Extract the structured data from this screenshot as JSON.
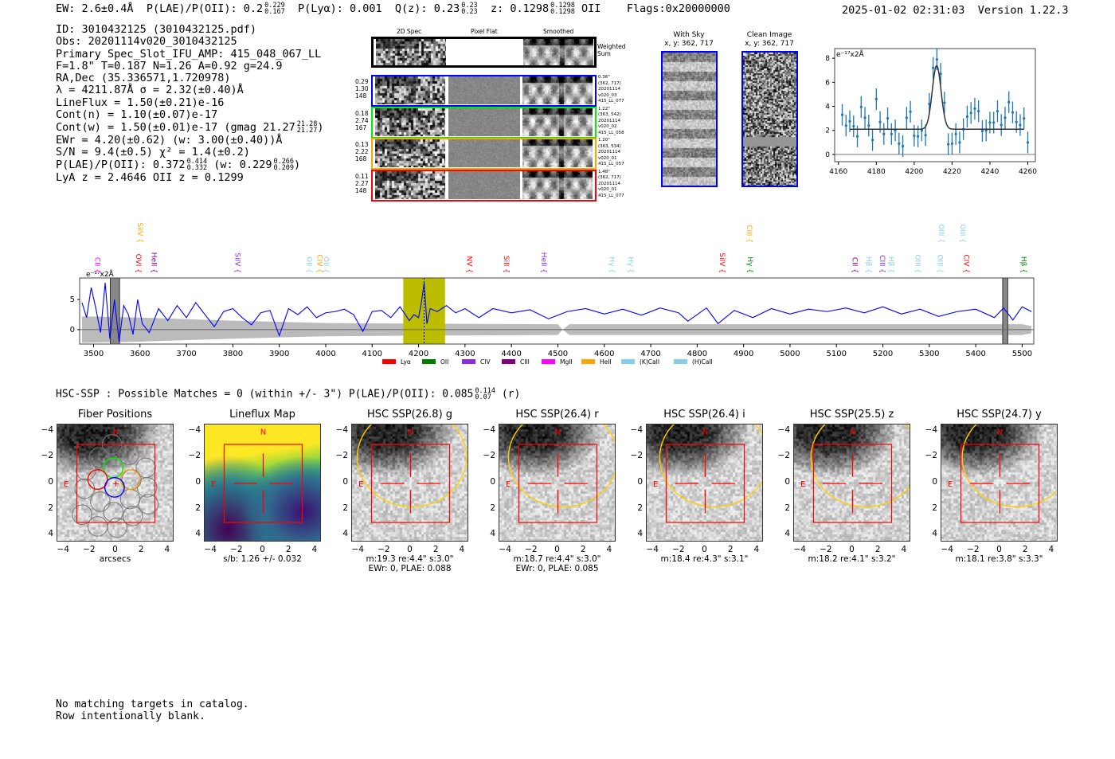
{
  "header": {
    "ew": "EW: 2.6±0.4Å",
    "plae_label": "P(LAE)/P(OII): 0.2",
    "plae_hi": "0.229",
    "plae_lo": "0.167",
    "plya": "P(Lyα): 0.001",
    "qz_label": "Q(z): 0.23",
    "qz_hi": "0.23",
    "qz_lo": "0.23",
    "z_label": "z: 0.1298",
    "z_hi": "0.1298",
    "z_lo": "0.1298",
    "z_line": "OII",
    "flags": "Flags:0x20000000",
    "datetime": "2025-01-02 02:31:03",
    "version": "Version 1.22.3"
  },
  "info": {
    "lines": [
      "ID: 3010432125 (3010432125.pdf)",
      "Obs: 20201114v020_3010432125",
      "Primary Spec_Slot_IFU_AMP: 415_048_067_LL",
      "F=1.8\"  T=0.187  N=1.26  A=0.92  g=24.9",
      "RA,Dec (35.336571,1.720978)",
      "λ = 4211.87Å   σ = 2.32(±0.40)Å",
      "LineFlux = 1.50(±0.21)e-16",
      "Cont(n) = 1.10(±0.07)e-17"
    ],
    "contw": "Cont(w) = 1.50(±0.01)e-17 (gmag 21.27",
    "contw_hi": "21.28",
    "contw_lo": "21.27",
    "contw_end": ")",
    "ewr": "EWr = 4.20(±0.62) (w: 3.00(±0.40))Å",
    "sn": "S/N = 9.4(±0.5)  χ² = 1.4(±0.2)",
    "plae": "P(LAE)/P(OII): 0.372",
    "plae_hi": "0.414",
    "plae_lo": "0.332",
    "plae_w": "(w: 0.229",
    "plae_w_hi": "0.266",
    "plae_w_lo": "0.209",
    "plae_w_end": ")",
    "z": "LyA z = 2.4646   OII z = 0.1299"
  },
  "spec2d": {
    "col_headers": [
      "2D Spec",
      "Pixel Flat",
      "Smoothed"
    ],
    "weighted_label": "Weighted Sum",
    "rows": [
      {
        "color": "#0000ff",
        "left": [
          "0.29",
          "1.30",
          "148"
        ],
        "right": [
          "0.36\"",
          "(362, 717)",
          "20201114",
          "v020_03",
          "415_LL_077"
        ]
      },
      {
        "color": "#00ee00",
        "left": [
          "0.18",
          "2.74",
          "167"
        ],
        "right": [
          "1.22\"",
          "(363, 542)",
          "20201114",
          "v020_02",
          "415_LL_058"
        ]
      },
      {
        "color": "#ffa500",
        "left": [
          "0.13",
          "2.22",
          "168"
        ],
        "right": [
          "1.20\"",
          "(363, 534)",
          "20201114",
          "v020_01",
          "415_LL_057"
        ]
      },
      {
        "color": "#ff0000",
        "left": [
          "0.11",
          "2.27",
          "148"
        ],
        "right": [
          "1.48\"",
          "(362, 717)",
          "20201114",
          "v020_01",
          "415_LL_077"
        ]
      }
    ]
  },
  "with_sky": {
    "title": "With Sky",
    "coords": "x, y: 362, 717"
  },
  "clean_image": {
    "title": "Clean Image",
    "coords": "x, y: 362, 717"
  },
  "chart_data": [
    {
      "type": "scatter",
      "name_hint": "line fit inset",
      "ylabel": "e⁻¹⁷x2Å",
      "xlim": [
        4158,
        4264
      ],
      "ylim": [
        -0.6,
        8.8
      ],
      "xticks": [
        4160,
        4180,
        4200,
        4220,
        4240,
        4260
      ],
      "yticks": [
        0,
        2,
        4,
        6,
        8
      ],
      "point_color": "#1f77b4",
      "x": [
        4162,
        4164,
        4166,
        4168,
        4170,
        4172,
        4174,
        4176,
        4178,
        4180,
        4182,
        4184,
        4186,
        4188,
        4190,
        4192,
        4194,
        4196,
        4198,
        4200,
        4202,
        4204,
        4206,
        4208,
        4210,
        4212,
        4214,
        4216,
        4218,
        4220,
        4222,
        4224,
        4226,
        4228,
        4230,
        4232,
        4234,
        4236,
        4238,
        4240,
        4242,
        4244,
        4246,
        4248,
        4250,
        4252,
        4254,
        4256,
        4258,
        4260
      ],
      "y": [
        3.3,
        2.4,
        2.75,
        2.35,
        1.5,
        3.95,
        3.05,
        2.4,
        1.2,
        4.6,
        2.7,
        1.7,
        3.0,
        1.7,
        2.0,
        0.9,
        0.7,
        3.05,
        3.55,
        1.55,
        1.5,
        2.0,
        1.6,
        4.2,
        7.2,
        7.9,
        6.7,
        4.3,
        0.85,
        0.9,
        1.7,
        1.0,
        2.1,
        3.15,
        3.45,
        3.8,
        3.6,
        1.95,
        2.0,
        2.65,
        2.65,
        3.6,
        2.45,
        3.05,
        4.35,
        3.5,
        2.7,
        2.45,
        3.0,
        1.0
      ],
      "yerr": 0.9,
      "fit": {
        "continuum": 2.1,
        "amplitude": 5.3,
        "center": 4211.87,
        "sigma": 2.32,
        "range": [
          4166,
          4258
        ]
      }
    },
    {
      "type": "line",
      "name_hint": "full spectrum",
      "ylabel": "e⁻¹⁷x2Å",
      "xlim": [
        3470,
        5525
      ],
      "ylim": [
        -2.4,
        8.6
      ],
      "xticks": [
        3500,
        3600,
        3700,
        3800,
        3900,
        4000,
        4100,
        4200,
        4300,
        4400,
        4500,
        4600,
        4700,
        4800,
        4900,
        5000,
        5100,
        5200,
        5300,
        5400,
        5500
      ],
      "yticks": [
        0,
        5
      ],
      "line_color": "#0000ff",
      "x": [
        3475,
        3485,
        3495,
        3505,
        3515,
        3525,
        3535,
        3545,
        3555,
        3565,
        3575,
        3585,
        3595,
        3605,
        3620,
        3640,
        3660,
        3680,
        3700,
        3720,
        3740,
        3760,
        3780,
        3800,
        3820,
        3840,
        3860,
        3880,
        3900,
        3920,
        3940,
        3960,
        3980,
        4000,
        4020,
        4040,
        4060,
        4080,
        4100,
        4120,
        4140,
        4160,
        4180,
        4190,
        4200,
        4206,
        4212,
        4218,
        4225,
        4240,
        4260,
        4280,
        4300,
        4330,
        4360,
        4400,
        4440,
        4480,
        4520,
        4560,
        4600,
        4640,
        4680,
        4720,
        4760,
        4780,
        4820,
        4845,
        4880,
        4920,
        4960,
        5000,
        5040,
        5080,
        5120,
        5160,
        5200,
        5240,
        5280,
        5320,
        5360,
        5400,
        5440,
        5460,
        5480,
        5500,
        5520
      ],
      "y": [
        4.5,
        2.0,
        7.0,
        3.5,
        -0.5,
        7.8,
        -1.5,
        5.0,
        -2.0,
        4.0,
        2.5,
        -0.8,
        5.0,
        1.0,
        -0.5,
        3.5,
        1.5,
        4.0,
        2.0,
        4.5,
        2.5,
        0.5,
        3.0,
        3.5,
        2.0,
        0.8,
        2.8,
        3.2,
        -1.0,
        3.5,
        2.5,
        3.8,
        2.0,
        2.8,
        3.0,
        3.4,
        2.5,
        -0.3,
        3.0,
        3.2,
        2.0,
        3.8,
        1.5,
        2.5,
        2.0,
        4.5,
        7.8,
        1.0,
        3.5,
        3.0,
        4.0,
        2.8,
        3.5,
        2.0,
        3.5,
        2.8,
        3.3,
        1.8,
        3.0,
        3.5,
        2.6,
        3.4,
        2.4,
        3.6,
        2.8,
        1.4,
        3.6,
        1.0,
        3.2,
        2.0,
        3.5,
        2.6,
        3.4,
        3.0,
        3.6,
        2.8,
        3.8,
        2.6,
        3.4,
        2.2,
        3.0,
        3.4,
        2.0,
        3.6,
        1.6,
        3.8,
        3.0
      ],
      "error_band": {
        "color": "#bbbbbb",
        "x": [
          3475,
          3600,
          3800,
          4000,
          4200,
          4500,
          4510,
          4525,
          5000,
          5500,
          5520
        ],
        "halfwidth": [
          2.2,
          2.0,
          1.5,
          1.1,
          1.0,
          0.9,
          0.0,
          0.9,
          0.9,
          0.9,
          0.6
        ]
      },
      "highlight": {
        "color": "#bdbd00",
        "range": [
          4167,
          4257
        ],
        "line_center": 4211.87
      },
      "masked": [
        [
          3536,
          3556
        ],
        [
          5458,
          5469
        ]
      ],
      "line_labels": [
        {
          "name": "CII",
          "w": 3498,
          "color": "#ff00ff",
          "row": "low"
        },
        {
          "name": "SiIV",
          "w": 3590,
          "color": "#ffa500",
          "row": "high"
        },
        {
          "name": "OVI",
          "w": 3587,
          "color": "#ff0000",
          "row": "low"
        },
        {
          "name": "HeII",
          "w": 3620,
          "color": "#800080",
          "row": "low"
        },
        {
          "name": "SiIV",
          "w": 3800,
          "color": "#8a2be2",
          "row": "low"
        },
        {
          "name": "OII",
          "w": 3955,
          "color": "#87ceeb",
          "row": "low"
        },
        {
          "name": "CIV",
          "w": 3977,
          "color": "#ffa500",
          "row": "low"
        },
        {
          "name": "OII",
          "w": 3991,
          "color": "#87ceeb",
          "row": "low"
        },
        {
          "name": "NV",
          "w": 4299,
          "color": "#ff0000",
          "row": "low"
        },
        {
          "name": "SiII",
          "w": 4379,
          "color": "#ff0000",
          "row": "low"
        },
        {
          "name": "HeII",
          "w": 4460,
          "color": "#8a2be2",
          "row": "low"
        },
        {
          "name": "Hγ",
          "w": 4606,
          "color": "#87ceeb",
          "row": "low"
        },
        {
          "name": "Hγ",
          "w": 4647,
          "color": "#87ceeb",
          "row": "low"
        },
        {
          "name": "SiIV",
          "w": 4844,
          "color": "#ff0000",
          "row": "low"
        },
        {
          "name": "CIII",
          "w": 4902,
          "color": "#ffa500",
          "row": "high"
        },
        {
          "name": "Hγ",
          "w": 4904,
          "color": "#008000",
          "row": "low"
        },
        {
          "name": "CII",
          "w": 5130,
          "color": "#800080",
          "row": "low"
        },
        {
          "name": "Hβ",
          "w": 5160,
          "color": "#87ceeb",
          "row": "low"
        },
        {
          "name": "CIII",
          "w": 5189,
          "color": "#8a2be2",
          "row": "low"
        },
        {
          "name": "Hβ",
          "w": 5208,
          "color": "#87ceeb",
          "row": "low"
        },
        {
          "name": "OIII",
          "w": 5265,
          "color": "#87ceeb",
          "row": "low"
        },
        {
          "name": "OIII",
          "w": 5313,
          "color": "#87ceeb",
          "row": "low"
        },
        {
          "name": "OIII",
          "w": 5316,
          "color": "#87ceeb",
          "row": "high"
        },
        {
          "name": "OIII",
          "w": 5362,
          "color": "#87ceeb",
          "row": "high"
        },
        {
          "name": "CIV",
          "w": 5370,
          "color": "#ff0000",
          "row": "low"
        },
        {
          "name": "Hβ",
          "w": 5493,
          "color": "#008000",
          "row": "low"
        }
      ],
      "legend": {
        "placement": "bottom-center",
        "entries": [
          {
            "name": "Lyα",
            "color": "#ff0000"
          },
          {
            "name": "OII",
            "color": "#008000"
          },
          {
            "name": "CIV",
            "color": "#8a2be2"
          },
          {
            "name": "CIII",
            "color": "#800080"
          },
          {
            "name": "MgII",
            "color": "#ff00ff"
          },
          {
            "name": "HeII",
            "color": "#ffa500"
          },
          {
            "name": "(K)CaII",
            "color": "#87ceeb"
          },
          {
            "name": "(H)CaII",
            "color": "#87ceeb"
          }
        ]
      }
    }
  ],
  "hsc": {
    "summary": "HSC-SSP : Possible Matches = 0 (within +/- 3\")  P(LAE)/P(OII): 0.085",
    "summary_hi": "0.114",
    "summary_lo": "0.07",
    "summary_end": "(r)",
    "ticks": [
      "−4",
      "−2",
      "0",
      "2",
      "4"
    ],
    "north": "N",
    "east": "E",
    "panels": [
      {
        "title": "Fiber Positions",
        "kind": "fiber",
        "captions": [
          "arcsecs"
        ]
      },
      {
        "title": "Lineflux Map",
        "kind": "lineflux",
        "captions": [
          "s/b: 1.26 +/- 0.032"
        ]
      },
      {
        "title": "HSC SSP(26.8) g",
        "kind": "hsc",
        "captions": [
          "m:19.3  re:4.4\"  s:3.0\"",
          "EWr: 0, PLAE: 0.088"
        ]
      },
      {
        "title": "HSC SSP(26.4) r",
        "kind": "hsc",
        "captions": [
          "m:18.7  re:4.4\"  s:3.0\"",
          "EWr: 0, PLAE: 0.085"
        ]
      },
      {
        "title": "HSC SSP(26.4) i",
        "kind": "hsc",
        "captions": [
          "m:18.4  re:4.3\"  s:3.1\""
        ]
      },
      {
        "title": "HSC SSP(25.5) z",
        "kind": "hsc",
        "captions": [
          "m:18.2  re:4.1\"  s:3.2\""
        ]
      },
      {
        "title": "HSC SSP(24.7) y",
        "kind": "hsc",
        "captions": [
          "m:18.1  re:3.8\"  s:3.3\""
        ]
      }
    ]
  },
  "footer": {
    "line1": "No matching targets in catalog.",
    "line2": "Row intentionally blank."
  }
}
